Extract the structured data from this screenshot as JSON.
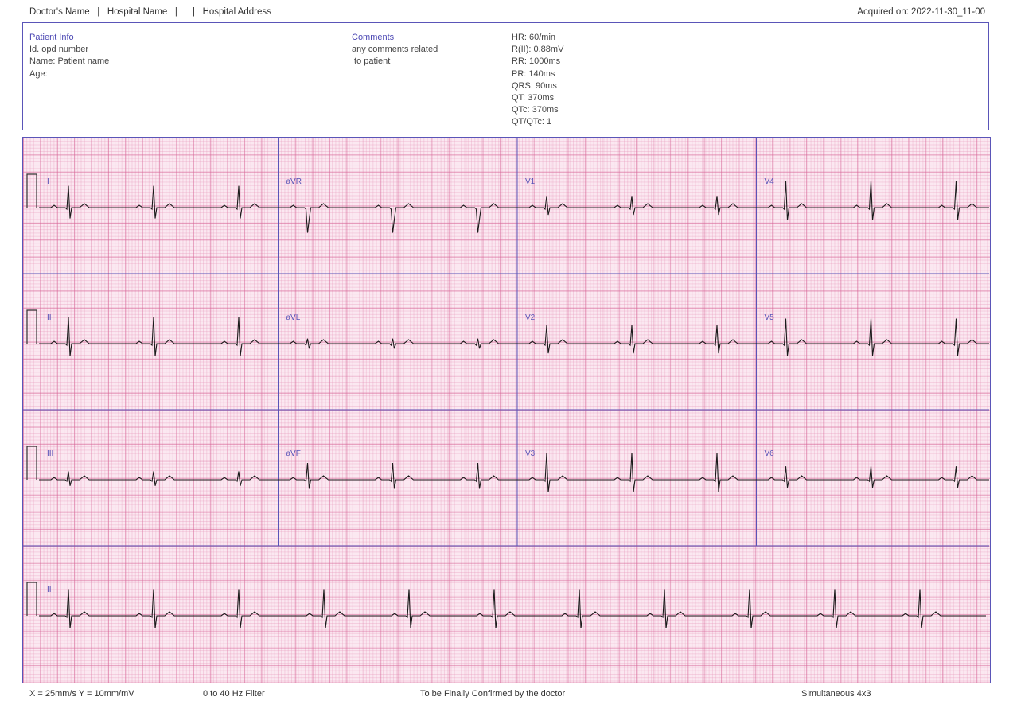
{
  "header": {
    "doctor_line": "Doctor's Name   |   Hospital Name   |      |   Hospital Address",
    "acquired": "Acquired on: 2022-11-30_11-00"
  },
  "patient": {
    "title": "Patient Info",
    "lines": [
      "Id. opd number",
      "Name: Patient name",
      "Age:"
    ]
  },
  "comments": {
    "title": "Comments",
    "lines": [
      "any comments related",
      " to patient"
    ]
  },
  "stats": [
    "HR: 60/min",
    "R(II): 0.88mV",
    "RR: 1000ms",
    "PR: 140ms",
    "QRS: 90ms",
    "QT: 370ms",
    "QTc: 370ms",
    "QT/QTc: 1"
  ],
  "ecg": {
    "rows": [
      [
        {
          "label": "I",
          "amp": 0.65
        },
        {
          "label": "aVR",
          "amp": -0.75
        },
        {
          "label": "V1",
          "amp": 0.35
        },
        {
          "label": "V4",
          "amp": 0.8
        }
      ],
      [
        {
          "label": "II",
          "amp": 0.8
        },
        {
          "label": "aVL",
          "amp": 0.15
        },
        {
          "label": "V2",
          "amp": 0.55
        },
        {
          "label": "V5",
          "amp": 0.75
        }
      ],
      [
        {
          "label": "III",
          "amp": 0.25
        },
        {
          "label": "aVF",
          "amp": 0.5
        },
        {
          "label": "V3",
          "amp": 0.8
        },
        {
          "label": "V6",
          "amp": 0.4
        }
      ],
      [
        {
          "label": "II",
          "amp": 0.8
        }
      ]
    ],
    "trace_color": "#1a1a1a",
    "label_color": "#5a55b8",
    "divider_color": "#5a55b8"
  },
  "footer": {
    "speed": "X = 25mm/s  Y = 10mm/mV",
    "filter": "0 to 40 Hz Filter",
    "confirm": "To be Finally Confirmed by the doctor",
    "layout": "Simultaneous 4x3"
  }
}
